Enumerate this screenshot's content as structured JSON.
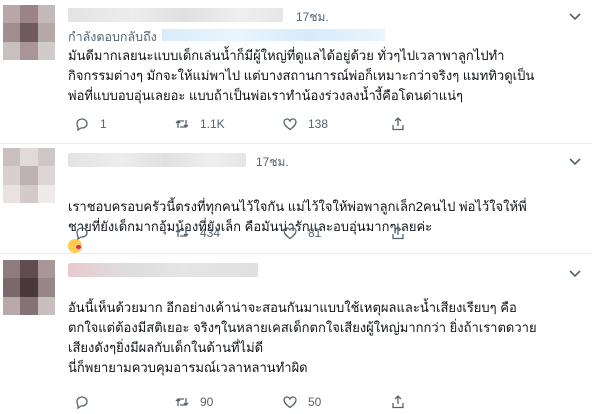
{
  "tweets": [
    {
      "time": "17ชม.",
      "replying_to_label": "กำลังตอบกลับถึง",
      "text": "มันดีมากเลยนะแบบเด็กเล่นน้ำก็มีผู้ใหญ่ที่ดูแลได้อยู่ด้วย ทั่วๆไปเวลาพาลูกไปทำ\nกิจกรรมต่างๆ มักจะให้แม่พาไป แต่บางสถานการณ์พ่อก็เหมาะกว่าจริงๆ แมททิวดูเป็น\nพ่อที่แบบอบอุ่นเลยอะ แบบถ้าเป็นพ่อเราทำน้องร่วงลงน้ำงี้คือโดนด่าแน่ๆ",
      "replies": "1",
      "retweets": "1.1K",
      "likes": "138"
    },
    {
      "time": "17ชม.",
      "text": "เราชอบครอบครัวนี้ตรงที่ทุกคนไว้ใจกัน แม่ไว้ใจให้พ่อพาลูกเล็ก2คนไป พ่อไว้ใจให้พี่\nชายที่ยังเด็กมากอุ้มน้องที่ยังเล็ก คือมันน่ารักและอบอุ่นมากๆเลยค่ะ",
      "replies": "",
      "retweets": "434",
      "likes": "81"
    },
    {
      "time": "",
      "text": "อันนี้เห็นด้วยมาก อีกอย่างเค้าน่าจะสอนกันมาแบบใช้เหตุผลและน้ำเสียงเรียบๆ คือ\nตกใจแต่ต้องมีสติเยอะ จริงๆในหลายเคสเด็กตกใจเสียงผู้ใหญ่มากกว่า ยิ่งถ้าเราตดวาย\nเสียงดังๆยิ่งมีผลกับเด็กในด้านที่ไม่ดี\nนี่ก็พยายามควบคุมอารมณ์เวลาหลานทำผิด",
      "replies": "",
      "retweets": "90",
      "likes": "50"
    }
  ],
  "icons": {
    "reply": "reply-icon",
    "retweet": "retweet-icon",
    "like": "heart-icon",
    "share": "share-icon",
    "more": "chevron-down-icon",
    "emoji": "kissing-heart-emoji"
  },
  "colors": {
    "text": "#0f1419",
    "secondary": "#536471",
    "divider": "#e6ecf0"
  }
}
